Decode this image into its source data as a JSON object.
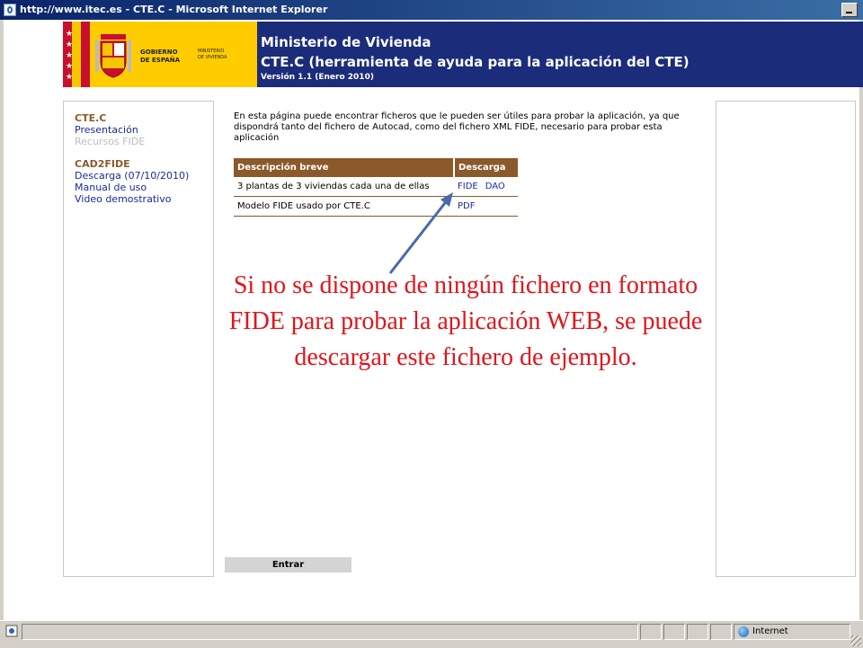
{
  "window": {
    "title": "http://www.itec.es - CTE.C - Microsoft Internet Explorer"
  },
  "header": {
    "logo": {
      "gobierno_line1": "GOBIERNO",
      "gobierno_line2": "DE ESPAÑA",
      "ministerio_line1": "MINISTERIO",
      "ministerio_line2": "DE VIVIENDA"
    },
    "ministry": "Ministerio de Vivienda",
    "app_title": "CTE.C (herramienta de ayuda para la aplicación del CTE)",
    "version": "Versión 1.1 (Enero 2010)"
  },
  "sidebar": {
    "section1": {
      "title": "CTE.C",
      "items": [
        "Presentación",
        "Recursos FIDE"
      ]
    },
    "section2": {
      "title": "CAD2FIDE",
      "items": [
        "Descarga (07/10/2010)",
        "Manual de uso",
        "Video demostrativo"
      ]
    }
  },
  "main": {
    "intro": "En esta página puede encontrar ficheros que le pueden ser útiles para probar la aplicación, ya que dispondrá tanto del fichero de Autocad, como del fichero XML FIDE, necesario para probar esta aplicación",
    "table": {
      "headers": [
        "Descripción breve",
        "Descarga"
      ],
      "rows": [
        {
          "description": "3 plantas de 3 viviendas cada una de ellas",
          "links": [
            "FIDE",
            "DAO"
          ]
        },
        {
          "description": "Modelo FIDE usado por CTE.C",
          "links": [
            "PDF"
          ]
        }
      ]
    },
    "enter_button": "Entrar"
  },
  "annotation": {
    "text": "Si no se dispone de ningún fichero en formato FIDE para probar la aplicación WEB, se puede descargar este fichero de ejemplo.",
    "color": "#e2141b"
  },
  "statusbar": {
    "zone": "Internet"
  },
  "colors": {
    "banner": "#1b2c7a",
    "logo_bg": "#ffcc00",
    "table_header": "#8b5a2b",
    "link": "#1a2a9a"
  }
}
